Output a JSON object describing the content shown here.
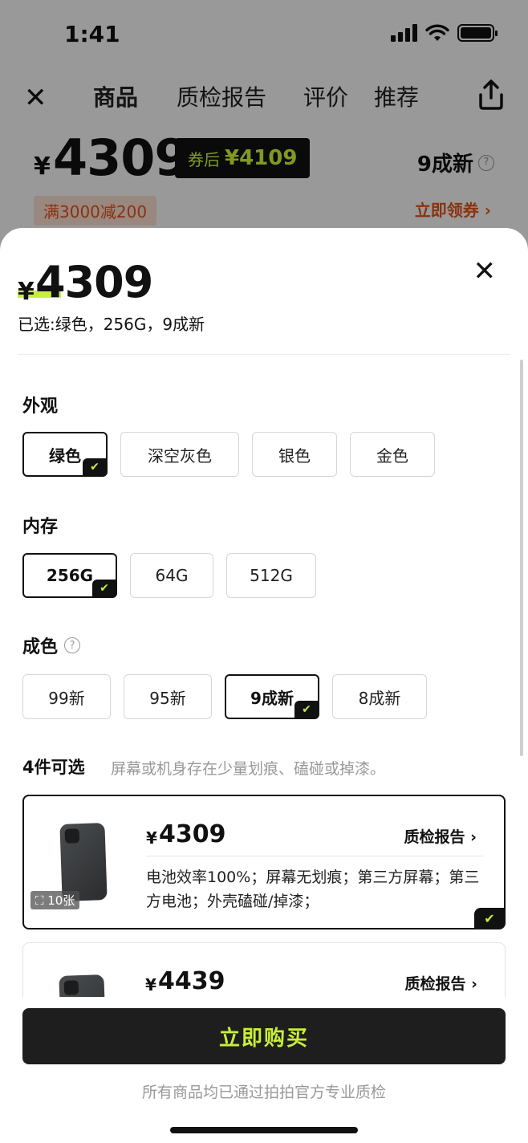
{
  "status": {
    "time": "1:41"
  },
  "nav": {
    "tabs": [
      "商品",
      "质检报告",
      "评价",
      "推荐"
    ]
  },
  "product_card": {
    "currency": "¥",
    "price": "4309",
    "coupon_label": "券后",
    "coupon_price": "¥4109",
    "condition": "9成新",
    "promo": "满3000减200",
    "claim": "立即领券 ›"
  },
  "sheet": {
    "currency": "¥",
    "price": "4309",
    "selected_text": "已选:绿色，256G，9成新",
    "appearance": {
      "title": "外观",
      "options": [
        "绿色",
        "深空灰色",
        "银色",
        "金色"
      ],
      "selected": "绿色"
    },
    "memory": {
      "title": "内存",
      "options": [
        "256G",
        "64G",
        "512G"
      ],
      "selected": "256G"
    },
    "condition": {
      "title": "成色",
      "options": [
        "99新",
        "95新",
        "9成新",
        "8成新"
      ],
      "selected": "9成新"
    },
    "available": {
      "count_label": "4件可选",
      "note": "屏幕或机身存在少量划痕、磕碰或掉漆。"
    },
    "items": [
      {
        "currency": "¥",
        "price": "4309",
        "report": "质检报告 ›",
        "desc": "电池效率100%；屏幕无划痕；第三方屏幕；第三方电池；外壳磕碰/掉漆；",
        "photos": "⛶ 10张"
      },
      {
        "currency": "¥",
        "price": "4439",
        "report": "质检报告 ›"
      }
    ],
    "buy_button": "立即购买",
    "footer_note": "所有商品均已通过拍拍官方专业质检"
  }
}
